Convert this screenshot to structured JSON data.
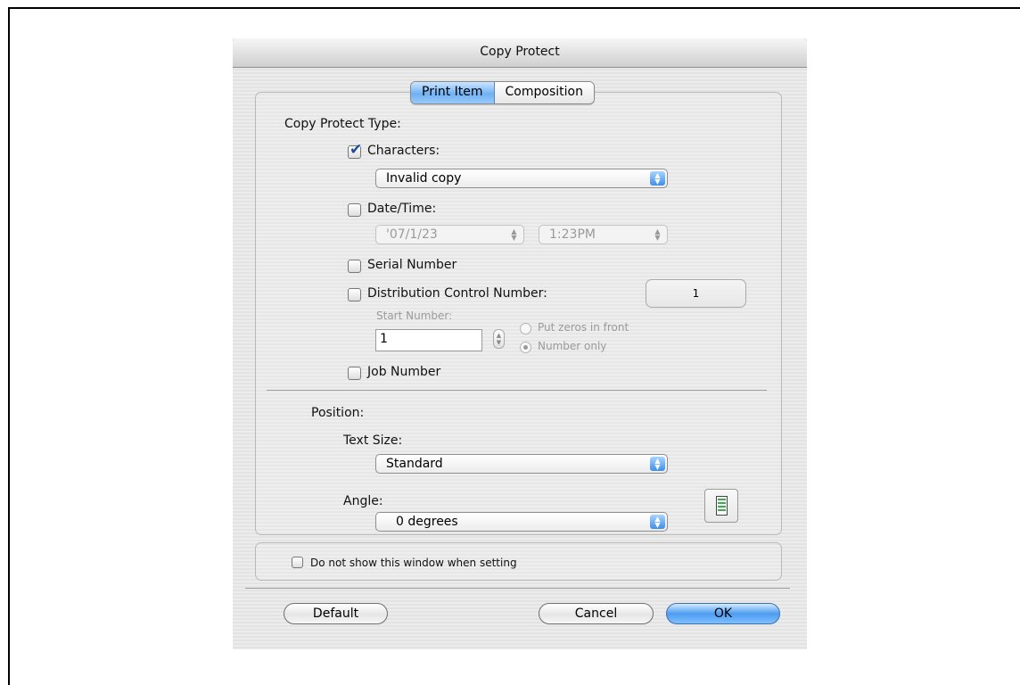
{
  "dialog": {
    "title": "Copy Protect",
    "tabs": [
      {
        "label": "Print Item",
        "active": true
      },
      {
        "label": "Composition",
        "active": false
      }
    ]
  },
  "copy_protect_type": {
    "heading": "Copy Protect Type:",
    "characters": {
      "label": "Characters:",
      "checked": true,
      "selected": "Invalid copy"
    },
    "date_time": {
      "label": "Date/Time:",
      "checked": false,
      "date": "'07/1/23",
      "time": "1:23PM"
    },
    "serial_number": {
      "label": "Serial Number",
      "checked": false
    },
    "distribution_control_number": {
      "label": "Distribution Control Number:",
      "checked": false,
      "count": "1",
      "start_number_label": "Start Number:",
      "start_number_value": "1",
      "radio_options": [
        {
          "label": "Put zeros in front",
          "selected": false
        },
        {
          "label": "Number only",
          "selected": true
        }
      ]
    },
    "job_number": {
      "label": "Job Number",
      "checked": false
    }
  },
  "position": {
    "heading": "Position:",
    "text_size": {
      "label": "Text Size:",
      "selected": "Standard"
    },
    "angle": {
      "label": "Angle:",
      "selected": "0 degrees"
    }
  },
  "footer": {
    "dont_show": {
      "label": "Do not show this window when setting",
      "checked": false
    },
    "buttons": {
      "default": "Default",
      "cancel": "Cancel",
      "ok": "OK"
    }
  },
  "colors": {
    "accent": "#4d9cf0"
  }
}
